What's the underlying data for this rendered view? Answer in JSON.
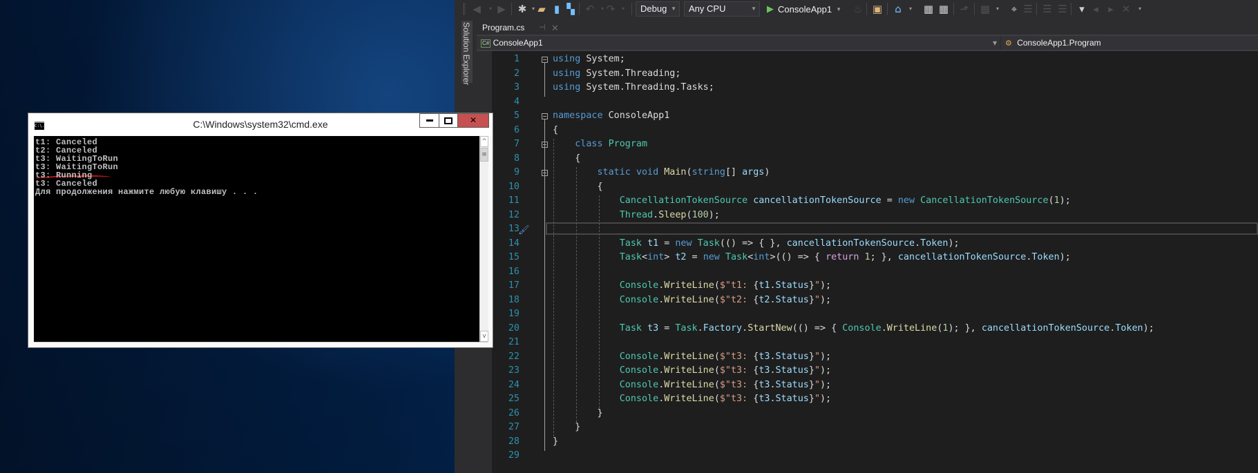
{
  "vs": {
    "toolbar": {
      "configuration": "Debug",
      "platform": "Any CPU",
      "start_target": "ConsoleApp1",
      "icons": [
        "back-icon",
        "forward-icon",
        "new-project-icon",
        "open-file-icon",
        "save-icon",
        "save-all-icon",
        "undo-icon",
        "redo-icon",
        "start-icon",
        "hot-reload-icon",
        "find-in-files-icon",
        "home-icon",
        "build-icon",
        "rebuild-icon",
        "step-out-icon",
        "breakpoints-icon",
        "comment-icon",
        "uncomment-icon",
        "outdent-icon",
        "indent-icon",
        "bookmark-icon",
        "prev-bookmark-icon",
        "next-bookmark-icon",
        "clear-bookmarks-icon"
      ]
    },
    "solution_explorer_label": "Solution Explorer",
    "document_tab": {
      "label": "Program.cs",
      "pin": "⊣",
      "close": "✕"
    },
    "navbar": {
      "project_badge": "C#",
      "project": "ConsoleApp1",
      "type": "ConsoleApp1.Program"
    },
    "editor": {
      "current_line": 13,
      "lines": [
        {
          "n": "1"
        },
        {
          "n": "2"
        },
        {
          "n": "3"
        },
        {
          "n": "4"
        },
        {
          "n": "5"
        },
        {
          "n": "6"
        },
        {
          "n": "7"
        },
        {
          "n": "8"
        },
        {
          "n": "9"
        },
        {
          "n": "10"
        },
        {
          "n": "11"
        },
        {
          "n": "12"
        },
        {
          "n": "13"
        },
        {
          "n": "14"
        },
        {
          "n": "15"
        },
        {
          "n": "16"
        },
        {
          "n": "17"
        },
        {
          "n": "18"
        },
        {
          "n": "19"
        },
        {
          "n": "20"
        },
        {
          "n": "21"
        },
        {
          "n": "22"
        },
        {
          "n": "23"
        },
        {
          "n": "24"
        },
        {
          "n": "25"
        },
        {
          "n": "26"
        },
        {
          "n": "27"
        },
        {
          "n": "28"
        },
        {
          "n": "29"
        }
      ],
      "code": [
        [
          [
            "k",
            "using"
          ],
          [
            "p",
            " System;"
          ]
        ],
        [
          [
            "k",
            "using"
          ],
          [
            "p",
            " System.Threading;"
          ]
        ],
        [
          [
            "k",
            "using"
          ],
          [
            "p",
            " System.Threading.Tasks;"
          ]
        ],
        [],
        [
          [
            "k",
            "namespace"
          ],
          [
            "p",
            " ConsoleApp1"
          ]
        ],
        [
          [
            "p",
            "{"
          ]
        ],
        [
          [
            "p",
            "    "
          ],
          [
            "k",
            "class"
          ],
          [
            "p",
            " "
          ],
          [
            "t",
            "Program"
          ]
        ],
        [
          [
            "p",
            "    {"
          ]
        ],
        [
          [
            "p",
            "        "
          ],
          [
            "k",
            "static"
          ],
          [
            "p",
            " "
          ],
          [
            "k",
            "void"
          ],
          [
            "p",
            " "
          ],
          [
            "m",
            "Main"
          ],
          [
            "p",
            "("
          ],
          [
            "k",
            "string"
          ],
          [
            "p",
            "[] "
          ],
          [
            "v",
            "args"
          ],
          [
            "p",
            ")"
          ]
        ],
        [
          [
            "p",
            "        {"
          ]
        ],
        [
          [
            "p",
            "            "
          ],
          [
            "t",
            "CancellationTokenSource"
          ],
          [
            "p",
            " "
          ],
          [
            "v",
            "cancellationTokenSource"
          ],
          [
            "p",
            " = "
          ],
          [
            "k",
            "new"
          ],
          [
            "p",
            " "
          ],
          [
            "t",
            "CancellationTokenSource"
          ],
          [
            "p",
            "("
          ],
          [
            "n",
            "1"
          ],
          [
            "p",
            ");"
          ]
        ],
        [
          [
            "p",
            "            "
          ],
          [
            "t",
            "Thread"
          ],
          [
            "p",
            "."
          ],
          [
            "m",
            "Sleep"
          ],
          [
            "p",
            "("
          ],
          [
            "n",
            "100"
          ],
          [
            "p",
            ");"
          ]
        ],
        [],
        [
          [
            "p",
            "            "
          ],
          [
            "t",
            "Task"
          ],
          [
            "p",
            " "
          ],
          [
            "v",
            "t1"
          ],
          [
            "p",
            " = "
          ],
          [
            "k",
            "new"
          ],
          [
            "p",
            " "
          ],
          [
            "t",
            "Task"
          ],
          [
            "p",
            "(() => { }, "
          ],
          [
            "v",
            "cancellationTokenSource"
          ],
          [
            "p",
            "."
          ],
          [
            "v",
            "Token"
          ],
          [
            "p",
            ");"
          ]
        ],
        [
          [
            "p",
            "            "
          ],
          [
            "t",
            "Task"
          ],
          [
            "p",
            "<"
          ],
          [
            "k",
            "int"
          ],
          [
            "p",
            "> "
          ],
          [
            "v",
            "t2"
          ],
          [
            "p",
            " = "
          ],
          [
            "k",
            "new"
          ],
          [
            "p",
            " "
          ],
          [
            "t",
            "Task"
          ],
          [
            "p",
            "<"
          ],
          [
            "k",
            "int"
          ],
          [
            "p",
            ">(() => { "
          ],
          [
            "c",
            "return"
          ],
          [
            "p",
            " "
          ],
          [
            "n",
            "1"
          ],
          [
            "p",
            "; }, "
          ],
          [
            "v",
            "cancellationTokenSource"
          ],
          [
            "p",
            "."
          ],
          [
            "v",
            "Token"
          ],
          [
            "p",
            ");"
          ]
        ],
        [],
        [
          [
            "p",
            "            "
          ],
          [
            "t",
            "Console"
          ],
          [
            "p",
            "."
          ],
          [
            "m",
            "WriteLine"
          ],
          [
            "p",
            "("
          ],
          [
            "s",
            "$\"t1: "
          ],
          [
            "p",
            "{"
          ],
          [
            "v",
            "t1"
          ],
          [
            "p",
            "."
          ],
          [
            "v",
            "Status"
          ],
          [
            "p",
            "}"
          ],
          [
            "s",
            "\""
          ],
          [
            "p",
            ");"
          ]
        ],
        [
          [
            "p",
            "            "
          ],
          [
            "t",
            "Console"
          ],
          [
            "p",
            "."
          ],
          [
            "m",
            "WriteLine"
          ],
          [
            "p",
            "("
          ],
          [
            "s",
            "$\"t2: "
          ],
          [
            "p",
            "{"
          ],
          [
            "v",
            "t2"
          ],
          [
            "p",
            "."
          ],
          [
            "v",
            "Status"
          ],
          [
            "p",
            "}"
          ],
          [
            "s",
            "\""
          ],
          [
            "p",
            ");"
          ]
        ],
        [],
        [
          [
            "p",
            "            "
          ],
          [
            "t",
            "Task"
          ],
          [
            "p",
            " "
          ],
          [
            "v",
            "t3"
          ],
          [
            "p",
            " = "
          ],
          [
            "t",
            "Task"
          ],
          [
            "p",
            "."
          ],
          [
            "v",
            "Factory"
          ],
          [
            "p",
            "."
          ],
          [
            "m",
            "StartNew"
          ],
          [
            "p",
            "(() => { "
          ],
          [
            "t",
            "Console"
          ],
          [
            "p",
            "."
          ],
          [
            "m",
            "WriteLine"
          ],
          [
            "p",
            "("
          ],
          [
            "n",
            "1"
          ],
          [
            "p",
            "); }, "
          ],
          [
            "v",
            "cancellationTokenSource"
          ],
          [
            "p",
            "."
          ],
          [
            "v",
            "Token"
          ],
          [
            "p",
            ");"
          ]
        ],
        [],
        [
          [
            "p",
            "            "
          ],
          [
            "t",
            "Console"
          ],
          [
            "p",
            "."
          ],
          [
            "m",
            "WriteLine"
          ],
          [
            "p",
            "("
          ],
          [
            "s",
            "$\"t3: "
          ],
          [
            "p",
            "{"
          ],
          [
            "v",
            "t3"
          ],
          [
            "p",
            "."
          ],
          [
            "v",
            "Status"
          ],
          [
            "p",
            "}"
          ],
          [
            "s",
            "\""
          ],
          [
            "p",
            ");"
          ]
        ],
        [
          [
            "p",
            "            "
          ],
          [
            "t",
            "Console"
          ],
          [
            "p",
            "."
          ],
          [
            "m",
            "WriteLine"
          ],
          [
            "p",
            "("
          ],
          [
            "s",
            "$\"t3: "
          ],
          [
            "p",
            "{"
          ],
          [
            "v",
            "t3"
          ],
          [
            "p",
            "."
          ],
          [
            "v",
            "Status"
          ],
          [
            "p",
            "}"
          ],
          [
            "s",
            "\""
          ],
          [
            "p",
            ");"
          ]
        ],
        [
          [
            "p",
            "            "
          ],
          [
            "t",
            "Console"
          ],
          [
            "p",
            "."
          ],
          [
            "m",
            "WriteLine"
          ],
          [
            "p",
            "("
          ],
          [
            "s",
            "$\"t3: "
          ],
          [
            "p",
            "{"
          ],
          [
            "v",
            "t3"
          ],
          [
            "p",
            "."
          ],
          [
            "v",
            "Status"
          ],
          [
            "p",
            "}"
          ],
          [
            "s",
            "\""
          ],
          [
            "p",
            ");"
          ]
        ],
        [
          [
            "p",
            "            "
          ],
          [
            "t",
            "Console"
          ],
          [
            "p",
            "."
          ],
          [
            "m",
            "WriteLine"
          ],
          [
            "p",
            "("
          ],
          [
            "s",
            "$\"t3: "
          ],
          [
            "p",
            "{"
          ],
          [
            "v",
            "t3"
          ],
          [
            "p",
            "."
          ],
          [
            "v",
            "Status"
          ],
          [
            "p",
            "}"
          ],
          [
            "s",
            "\""
          ],
          [
            "p",
            ");"
          ]
        ],
        [
          [
            "p",
            "        }"
          ]
        ],
        [
          [
            "p",
            "    }"
          ]
        ],
        [
          [
            "p",
            "}"
          ]
        ],
        []
      ]
    }
  },
  "cmd": {
    "title": "C:\\Windows\\system32\\cmd.exe",
    "icon_label": "C:\\.",
    "buttons": {
      "minimize": "minimize",
      "maximize": "maximize",
      "close": "✕"
    },
    "output": [
      "t1: Canceled",
      "t2: Canceled",
      "t3: WaitingToRun",
      "t3: WaitingToRun",
      "t3: Running",
      "t3: Canceled",
      "Для продолжения нажмите любую клавишу . . ."
    ],
    "highlighted_line": "t3: Running",
    "annotation_color": "#d8141a",
    "scrollbar": {
      "up": "^",
      "down": "v",
      "thumb": "≡"
    }
  }
}
